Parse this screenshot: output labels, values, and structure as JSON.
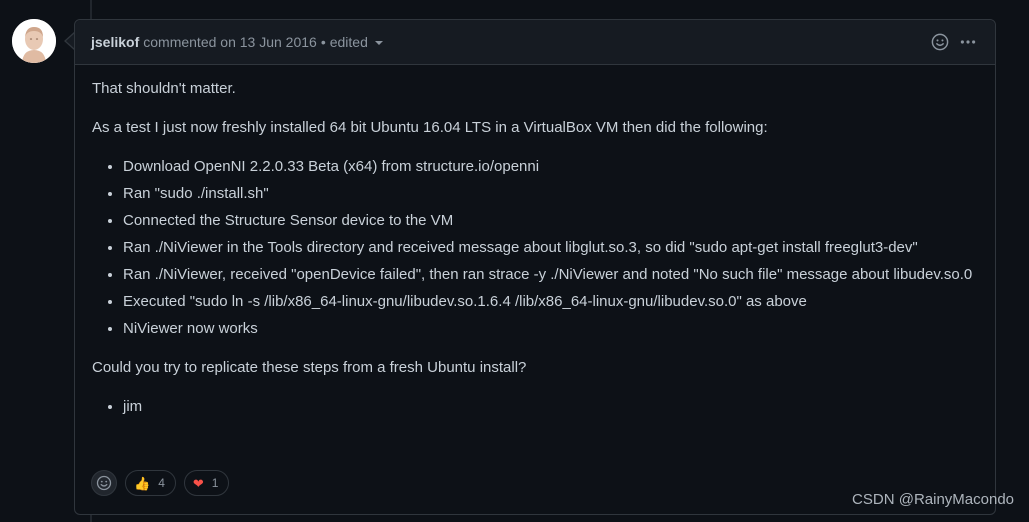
{
  "header": {
    "author": "jselikof",
    "meta": "commented on 13 Jun 2016",
    "separator": "•",
    "edited": "edited"
  },
  "body": {
    "intro": "That shouldn't matter.",
    "test_intro": "As a test I just now freshly installed 64 bit Ubuntu 16.04 LTS in a VirtualBox VM then did the following:",
    "steps": [
      "Download OpenNI 2.2.0.33 Beta (x64) from structure.io/openni",
      "Ran \"sudo ./install.sh\"",
      "Connected the Structure Sensor device to the VM",
      "Ran ./NiViewer in the Tools directory and received message about libglut.so.3, so did \"sudo apt-get install freeglut3-dev\"",
      "Ran ./NiViewer, received \"openDevice failed\", then ran strace -y ./NiViewer and noted \"No such file\" message about libudev.so.0",
      "Executed \"sudo ln -s /lib/x86_64-linux-gnu/libudev.so.1.6.4 /lib/x86_64-linux-gnu/libudev.so.0\" as above",
      "NiViewer now works"
    ],
    "question": "Could you try to replicate these steps from a fresh Ubuntu install?",
    "signature": "jim"
  },
  "reactions": [
    {
      "emoji": "👍",
      "count": "4"
    },
    {
      "emoji": "❤",
      "count": "1"
    }
  ],
  "watermark": "CSDN @RainyMacondo",
  "icons": {
    "emoji": "smiley-icon",
    "more": "kebab-horizontal-icon"
  },
  "colors": {
    "background": "#0d1117",
    "header_bg": "#161b22",
    "border": "#30363d",
    "text": "#c9d1d9",
    "muted": "#8b949e",
    "heart": "#f85149"
  }
}
